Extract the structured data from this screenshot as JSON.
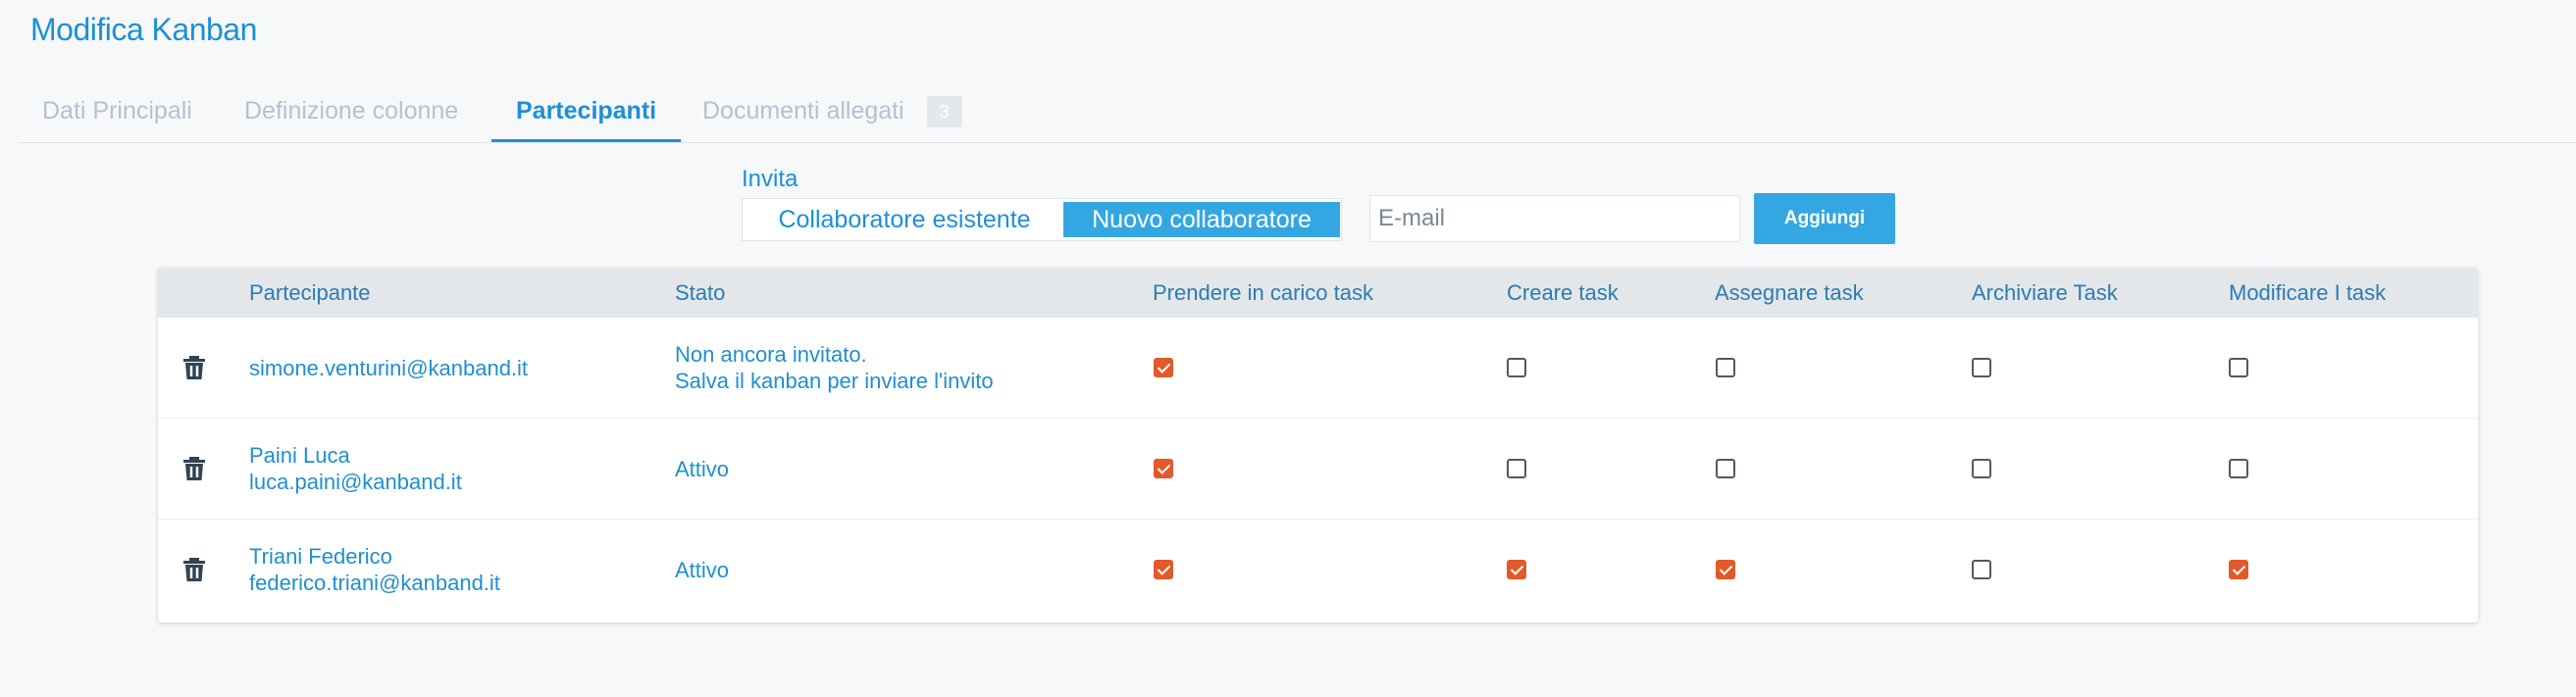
{
  "page": {
    "title": "Modifica Kanban"
  },
  "tabs": [
    {
      "label": "Dati Principali"
    },
    {
      "label": "Definizione colonne"
    },
    {
      "label": "Partecipanti"
    },
    {
      "label": "Documenti allegati",
      "badge": "3"
    }
  ],
  "active_tab": "Partecipanti",
  "invite": {
    "label": "Invita",
    "options": [
      "Collaboratore esistente",
      "Nuovo collaboratore"
    ],
    "selected": "Nuovo collaboratore",
    "email_placeholder": "E-mail",
    "email_value": "",
    "add_label": "Aggiungi"
  },
  "table": {
    "headers": [
      "Partecipante",
      "Stato",
      "Prendere in carico task",
      "Creare task",
      "Assegnare task",
      "Archiviare Task",
      "Modificare I task"
    ],
    "rows": [
      {
        "participant_line1": "simone.venturini@kanband.it",
        "participant_line2": "",
        "status_line1": "Non ancora invitato.",
        "status_line2": "Salva il kanban per inviare l'invito",
        "permissions": [
          true,
          false,
          false,
          false,
          false
        ]
      },
      {
        "participant_line1": "Paini Luca",
        "participant_line2": "luca.paini@kanband.it",
        "status_line1": "Attivo",
        "status_line2": "",
        "permissions": [
          true,
          false,
          false,
          false,
          false
        ]
      },
      {
        "participant_line1": "Triani Federico",
        "participant_line2": "federico.triani@kanband.it",
        "status_line1": "Attivo",
        "status_line2": "",
        "permissions": [
          true,
          true,
          true,
          false,
          true
        ]
      }
    ]
  },
  "icons": {
    "delete": "trash-icon"
  },
  "colors": {
    "accent": "#1d8fd6",
    "button": "#34a7e3",
    "checked": "#e2592a",
    "header_bg": "#e4e7ea"
  }
}
